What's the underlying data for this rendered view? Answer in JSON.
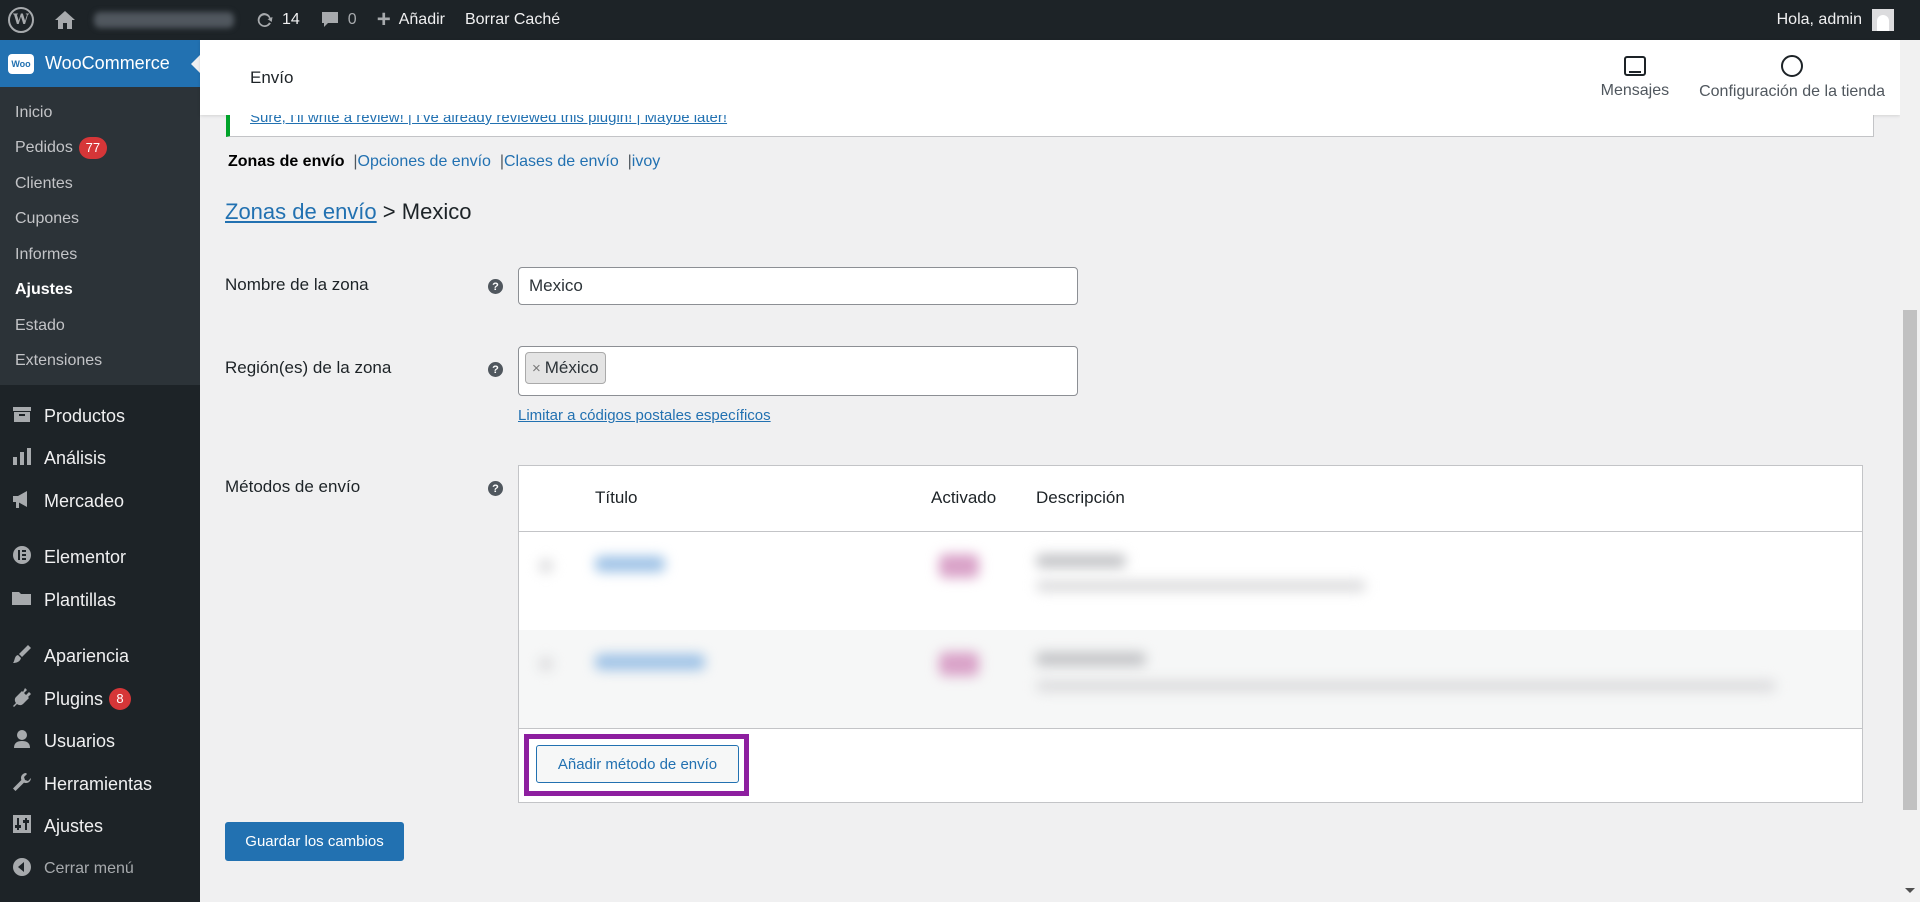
{
  "admin_bar": {
    "update_count": "14",
    "comment_count": "0",
    "add_label": "Añadir",
    "clear_cache_label": "Borrar Caché",
    "greeting": "Hola, admin"
  },
  "sidebar": {
    "woocommerce_label": "WooCommerce",
    "woo_logo_text": "Woo",
    "woo_submenu": [
      {
        "label": "Inicio"
      },
      {
        "label": "Pedidos",
        "badge": "77"
      },
      {
        "label": "Clientes"
      },
      {
        "label": "Cupones"
      },
      {
        "label": "Informes"
      },
      {
        "label": "Ajustes",
        "current": true
      },
      {
        "label": "Estado"
      },
      {
        "label": "Extensiones"
      }
    ],
    "menu": [
      {
        "label": "Productos",
        "icon": "archive-icon"
      },
      {
        "label": "Análisis",
        "icon": "bar-chart-icon"
      },
      {
        "label": "Mercadeo",
        "icon": "megaphone-icon"
      },
      {
        "label": "Elementor",
        "icon": "elementor-icon"
      },
      {
        "label": "Plantillas",
        "icon": "folder-icon"
      },
      {
        "label": "Apariencia",
        "icon": "paint-brush-icon"
      },
      {
        "label": "Plugins",
        "icon": "plugin-icon",
        "badge": "8"
      },
      {
        "label": "Usuarios",
        "icon": "user-icon"
      },
      {
        "label": "Herramientas",
        "icon": "wrench-icon"
      },
      {
        "label": "Ajustes",
        "icon": "settings-icon"
      },
      {
        "label": "Cerrar menú",
        "icon": "collapse-icon"
      }
    ]
  },
  "header": {
    "title": "Envío",
    "messages_label": "Mensajes",
    "store_setup_label": "Configuración de la tienda"
  },
  "notice": {
    "links_text": "Sure, I'll write a review! | I've already reviewed this plugin! | Maybe later!"
  },
  "tabs": {
    "current": "Zonas de envío",
    "options": "Opciones de envío",
    "classes": "Clases de envío",
    "ivoy": "ivoy"
  },
  "breadcrumb": {
    "link": "Zonas de envío",
    "separator": ">",
    "current": "Mexico"
  },
  "form": {
    "zone_name_label": "Nombre de la zona",
    "zone_name_value": "Mexico",
    "regions_label": "Región(es) de la zona",
    "region_token": "México",
    "postcode_link": "Limitar a códigos postales específicos",
    "methods_label": "Métodos de envío",
    "help_glyph": "?"
  },
  "methods_table": {
    "col_title": "Título",
    "col_enabled": "Activado",
    "col_description": "Descripción",
    "add_method_label": "Añadir método de envío"
  },
  "actions": {
    "save_label": "Guardar los cambios"
  },
  "colors": {
    "admin_bar_bg": "#1d2327",
    "accent_blue": "#2271b1",
    "badge_red": "#d63638",
    "highlight_purple": "#8e1fa0"
  }
}
